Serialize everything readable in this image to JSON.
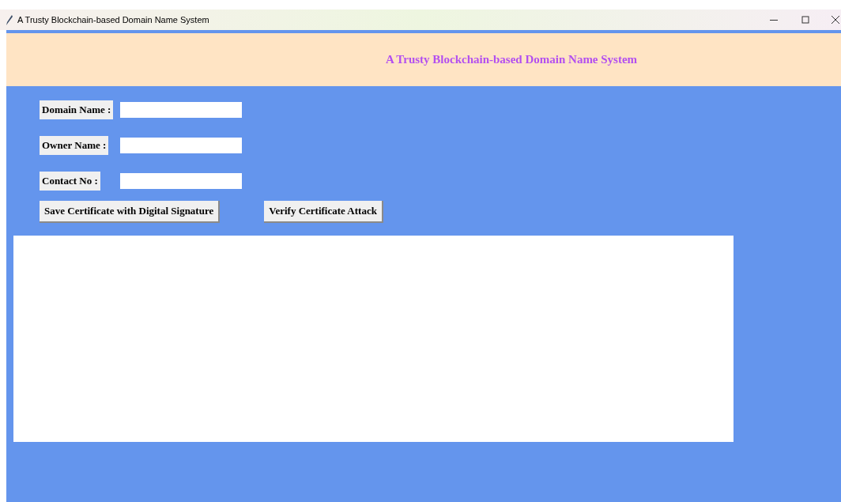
{
  "window": {
    "title": "A Trusty Blockchain-based Domain Name System"
  },
  "header": {
    "title": "A Trusty Blockchain-based Domain Name System"
  },
  "fields": [
    {
      "label": "Domain Name :"
    },
    {
      "label": "Owner Name :"
    },
    {
      "label": "Contact No :"
    }
  ],
  "buttons": [
    "Save Certificate with Digital Signature",
    "Verify Certificate Attack"
  ]
}
